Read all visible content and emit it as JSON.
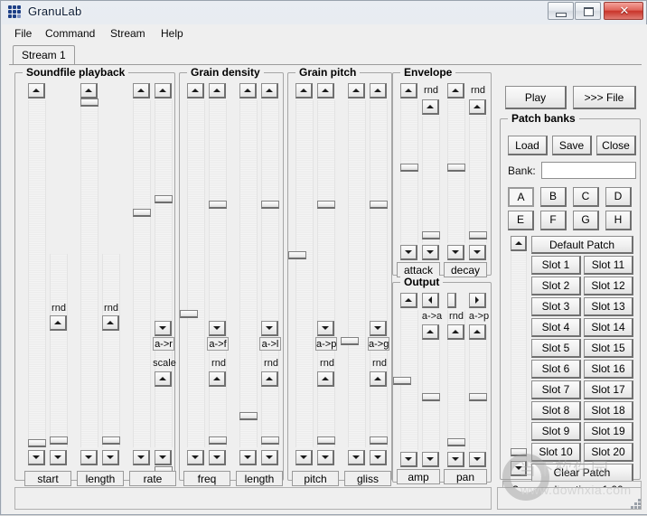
{
  "window": {
    "title": "GranuLab",
    "icon": "granulab-dots-icon",
    "buttons": {
      "minimize": "minimize-icon",
      "maximize": "maximize-icon",
      "close": "✕"
    }
  },
  "menubar": {
    "items": [
      {
        "label": "File"
      },
      {
        "label": "Command"
      },
      {
        "label": "Stream"
      },
      {
        "label": "Help"
      }
    ]
  },
  "tabs": [
    {
      "label": "Stream 1",
      "active": true
    }
  ],
  "groups": {
    "soundfile_playback": {
      "title": "Soundfile playback",
      "params": [
        {
          "name": "start",
          "rnd_label": "rnd",
          "has_rnd": true,
          "map_label": "",
          "has_map": false
        },
        {
          "name": "length",
          "rnd_label": "rnd",
          "has_rnd": true,
          "map_label": "",
          "has_map": false
        },
        {
          "name": "rate",
          "rnd_label": "scale",
          "has_rnd": true,
          "map_label": "a->r",
          "has_map": true
        }
      ],
      "footer_labels": [
        "start",
        "length",
        "rate"
      ]
    },
    "grain_density": {
      "title": "Grain density",
      "params": [
        {
          "name": "freq",
          "rnd_label": "rnd",
          "has_rnd": true,
          "map_label": "a->f",
          "has_map": true
        },
        {
          "name": "length",
          "rnd_label": "rnd",
          "has_rnd": true,
          "map_label": "a->l",
          "has_map": true
        }
      ],
      "footer_labels": [
        "freq",
        "length"
      ]
    },
    "grain_pitch": {
      "title": "Grain pitch",
      "params": [
        {
          "name": "pitch",
          "rnd_label": "rnd",
          "has_rnd": true,
          "map_label": "a->p",
          "has_map": true
        },
        {
          "name": "gliss",
          "rnd_label": "rnd",
          "has_rnd": true,
          "map_label": "a->g",
          "has_map": true
        }
      ],
      "footer_labels": [
        "pitch",
        "gliss"
      ]
    },
    "envelope": {
      "title": "Envelope",
      "params": [
        {
          "name": "attack",
          "rnd_label": "rnd",
          "has_rnd": true
        },
        {
          "name": "decay",
          "rnd_label": "rnd",
          "has_rnd": true
        }
      ],
      "footer_labels": [
        "attack",
        "decay"
      ]
    },
    "output": {
      "title": "Output",
      "params": [
        {
          "name": "amp",
          "rnd_label": "a->a",
          "has_rnd": true
        },
        {
          "name": "pan",
          "rnd_label": "rnd",
          "second_label": "a->p",
          "has_rnd": true
        }
      ],
      "footer_labels": [
        "amp",
        "pan"
      ]
    }
  },
  "transport": {
    "play_label": "Play",
    "file_label": ">>> File"
  },
  "patch_banks": {
    "title": "Patch banks",
    "load_label": "Load",
    "save_label": "Save",
    "close_label": "Close",
    "bank_label": "Bank:",
    "bank_value": "",
    "bank_placeholder": "",
    "banks": [
      "A",
      "B",
      "C",
      "D",
      "E",
      "F",
      "G",
      "H"
    ],
    "selected_bank": "A",
    "default_patch_label": "Default Patch",
    "slots_left": [
      "Slot 1",
      "Slot 2",
      "Slot 3",
      "Slot 4",
      "Slot 5",
      "Slot 6",
      "Slot 7",
      "Slot 8",
      "Slot 9",
      "Slot 10"
    ],
    "slots_right": [
      "Slot 11",
      "Slot 12",
      "Slot 13",
      "Slot 14",
      "Slot 15",
      "Slot 16",
      "Slot 17",
      "Slot 18",
      "Slot 19",
      "Slot 20"
    ],
    "clear_patch_label": "Clear Patch",
    "status_text": "? parm chng time: 1.00 s"
  },
  "status_bar": {
    "left_text": "",
    "right_text": ""
  },
  "watermark": {
    "cn_text": "当下软件园",
    "url_text": "www.downxia.com"
  },
  "colors": {
    "accent": "#1d3f86",
    "close_button": "#c9342a",
    "panel": "#efefef",
    "border": "#a6a6a6"
  }
}
